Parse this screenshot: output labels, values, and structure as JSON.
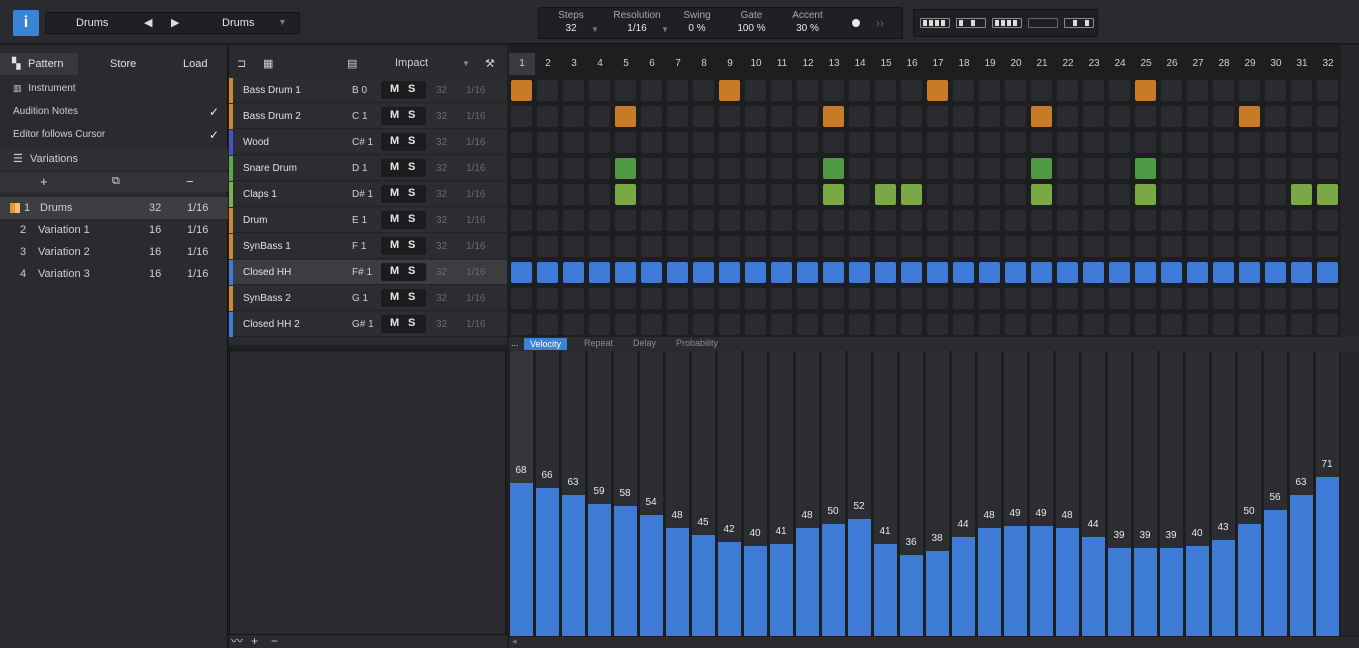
{
  "topbar": {
    "info_label": "i",
    "preset_name": "Drums",
    "prev_icon": "◀",
    "next_icon": "▶",
    "kit_name": "Drums",
    "dropdown_icon": "▼",
    "params": [
      {
        "label": "Steps",
        "value": "32"
      },
      {
        "label": "Resolution",
        "value": "1/16"
      },
      {
        "label": "Swing",
        "value": "0 %"
      },
      {
        "label": "Gate",
        "value": "100 %"
      },
      {
        "label": "Accent",
        "value": "30 %"
      }
    ],
    "ffwd_icon": "››"
  },
  "left": {
    "tab_pattern": "Pattern",
    "tab_store": "Store",
    "tab_load": "Load",
    "instrument_label": "Instrument",
    "audition_label": "Audition Notes",
    "follow_label": "Editor follows Cursor",
    "check": "✓",
    "variations_label": "Variations",
    "add": "+",
    "copy": "⧉",
    "remove": "−",
    "variations": [
      {
        "num": "1",
        "name": "Drums",
        "steps": "32",
        "res": "1/16"
      },
      {
        "num": "2",
        "name": "Variation 1",
        "steps": "16",
        "res": "1/16"
      },
      {
        "num": "3",
        "name": "Variation 2",
        "steps": "16",
        "res": "1/16"
      },
      {
        "num": "4",
        "name": "Variation 3",
        "steps": "16",
        "res": "1/16"
      }
    ]
  },
  "trackhdr": {
    "kit_label": "Impact",
    "wrench_icon": "⚒"
  },
  "tracks": [
    {
      "name": "Bass Drum 1",
      "note": "B 0",
      "steps": "32",
      "res": "1/16",
      "color": "#d4882e"
    },
    {
      "name": "Bass Drum 2",
      "note": "C 1",
      "steps": "32",
      "res": "1/16",
      "color": "#d4882e"
    },
    {
      "name": "Wood",
      "note": "C# 1",
      "steps": "32",
      "res": "1/16",
      "color": "#4a4fc2"
    },
    {
      "name": "Snare Drum",
      "note": "D 1",
      "steps": "32",
      "res": "1/16",
      "color": "#5aa84e"
    },
    {
      "name": "Claps 1",
      "note": "D# 1",
      "steps": "32",
      "res": "1/16",
      "color": "#7fb34a"
    },
    {
      "name": "Drum",
      "note": "E 1",
      "steps": "32",
      "res": "1/16",
      "color": "#d4882e"
    },
    {
      "name": "SynBass 1",
      "note": "F 1",
      "steps": "32",
      "res": "1/16",
      "color": "#d4882e"
    },
    {
      "name": "Closed HH",
      "note": "F# 1",
      "steps": "32",
      "res": "1/16",
      "color": "#3d7bd6"
    },
    {
      "name": "SynBass 2",
      "note": "G 1",
      "steps": "32",
      "res": "1/16",
      "color": "#d4882e"
    },
    {
      "name": "Closed HH 2",
      "note": "G# 1",
      "steps": "32",
      "res": "1/16",
      "color": "#3d7bd6"
    }
  ],
  "ms": {
    "m": "M",
    "s": "S"
  },
  "steps_header": [
    "1",
    "2",
    "3",
    "4",
    "5",
    "6",
    "7",
    "8",
    "9",
    "10",
    "11",
    "12",
    "13",
    "14",
    "15",
    "16",
    "17",
    "18",
    "19",
    "20",
    "21",
    "22",
    "23",
    "24",
    "25",
    "26",
    "27",
    "28",
    "29",
    "30",
    "31",
    "32"
  ],
  "pattern": [
    [
      1,
      9,
      17,
      25
    ],
    [
      5,
      13,
      21,
      29
    ],
    [],
    [
      5,
      13,
      21,
      25
    ],
    [
      5,
      13,
      15,
      16,
      21,
      25,
      31,
      32
    ],
    [],
    [],
    [
      1,
      2,
      3,
      4,
      5,
      6,
      7,
      8,
      9,
      10,
      11,
      12,
      13,
      14,
      15,
      16,
      17,
      18,
      19,
      20,
      21,
      22,
      23,
      24,
      25,
      26,
      27,
      28,
      29,
      30,
      31,
      32
    ],
    [],
    []
  ],
  "step_colors": [
    "#c97a26",
    "#c97a26",
    "#4a4fc2",
    "#4e9a45",
    "#7aa847",
    "#c97a26",
    "#c97a26",
    "#3d7bd6",
    "#c97a26",
    "#3d7bd6"
  ],
  "lanes": {
    "dots": "...",
    "tabs": [
      "Velocity",
      "Repeat",
      "Delay",
      "Probability"
    ]
  },
  "velocity": [
    68,
    66,
    63,
    59,
    58,
    54,
    48,
    45,
    42,
    40,
    41,
    48,
    50,
    52,
    41,
    36,
    38,
    44,
    48,
    49,
    49,
    48,
    44,
    39,
    39,
    39,
    40,
    43,
    50,
    56,
    63,
    71
  ],
  "lower_tools": {
    "curve": "〰",
    "add": "+",
    "remove": "−"
  },
  "scroll_left": "◂"
}
